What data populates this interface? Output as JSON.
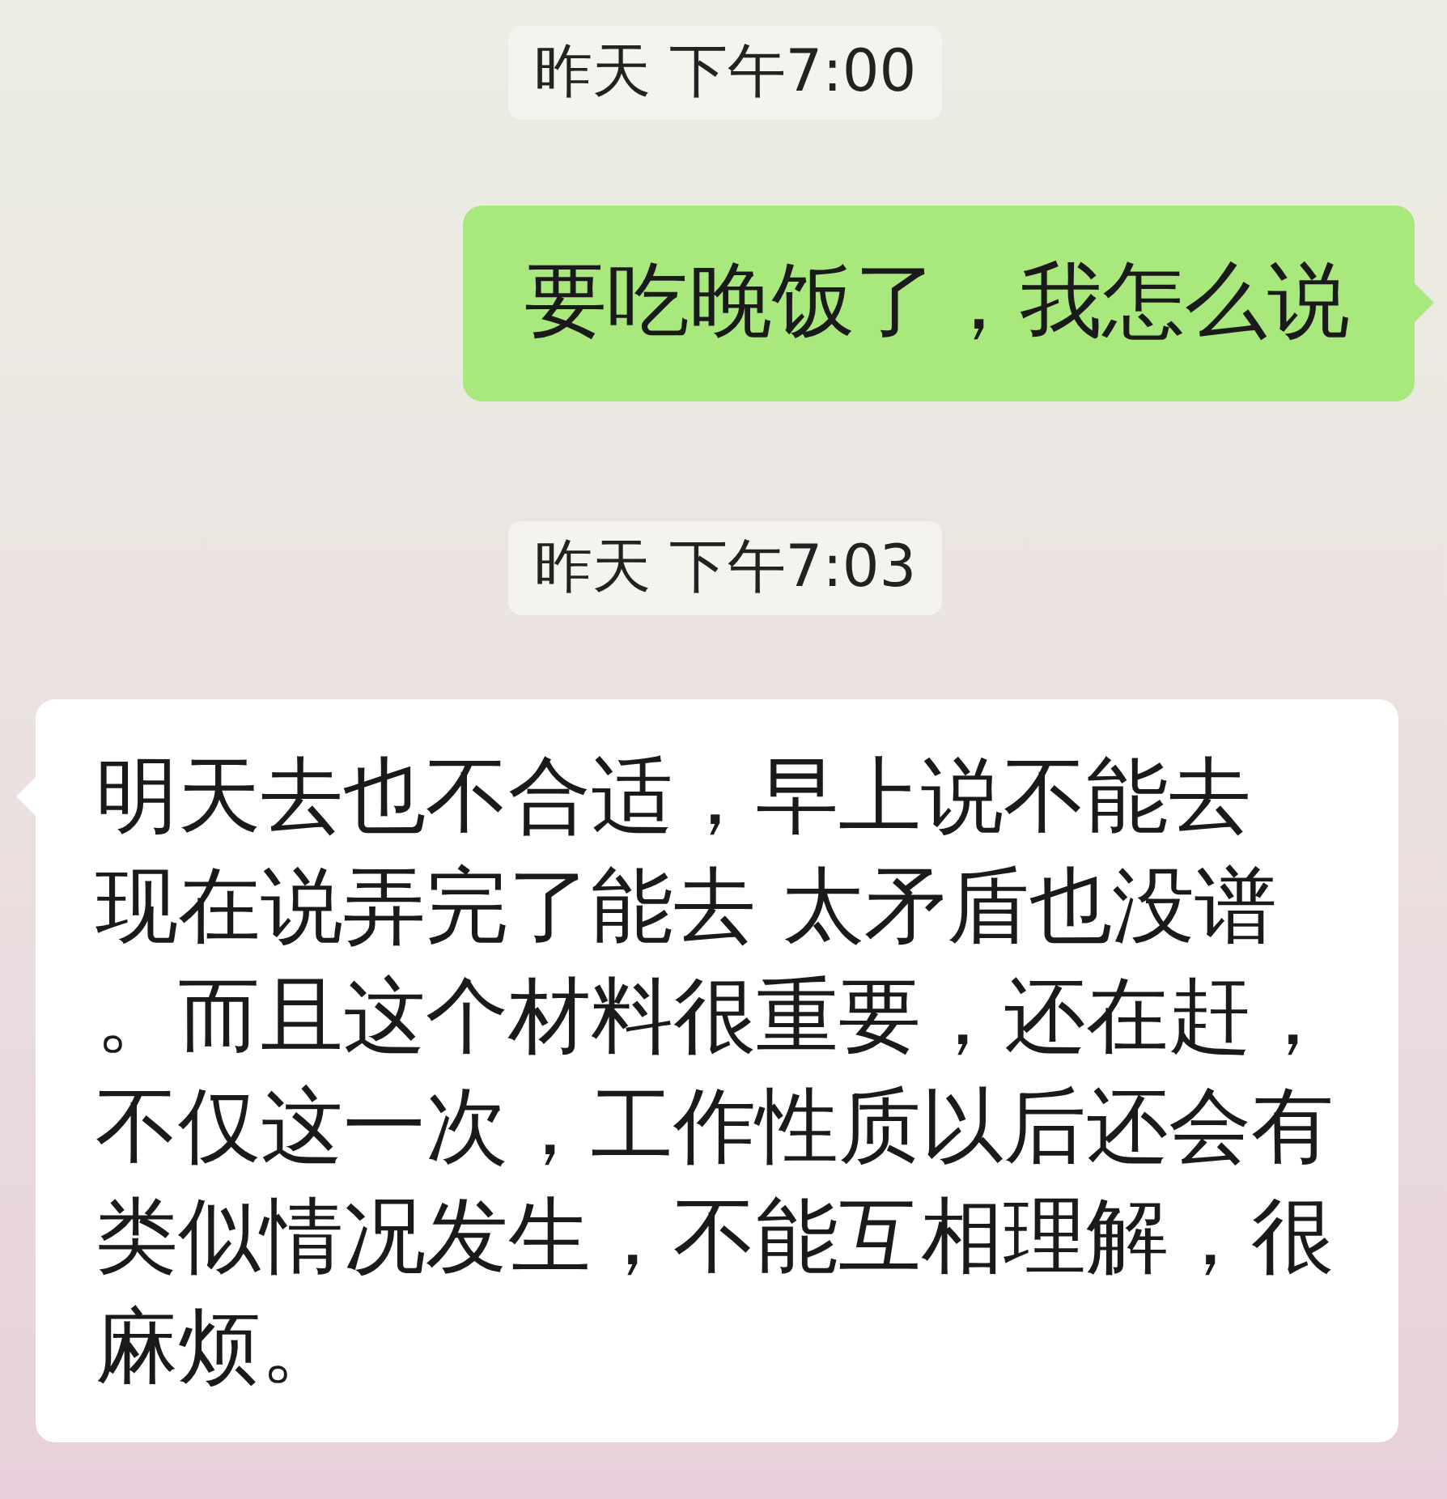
{
  "messages": [
    {
      "kind": "timestamp",
      "text": "昨天 下午7:00"
    },
    {
      "kind": "sent",
      "text": "要吃晚饭了，我怎么说"
    },
    {
      "kind": "timestamp",
      "text": "昨天 下午7:03"
    },
    {
      "kind": "received",
      "lines": [
        "明天去也不合适，早上说不能去",
        "现在说弄完了能去 太矛盾也没谱。而且这个材料很重要，还在赶，不仅这一次，工作性质以后还会有类似情况发生，不能互相理解，很麻烦。"
      ]
    }
  ]
}
